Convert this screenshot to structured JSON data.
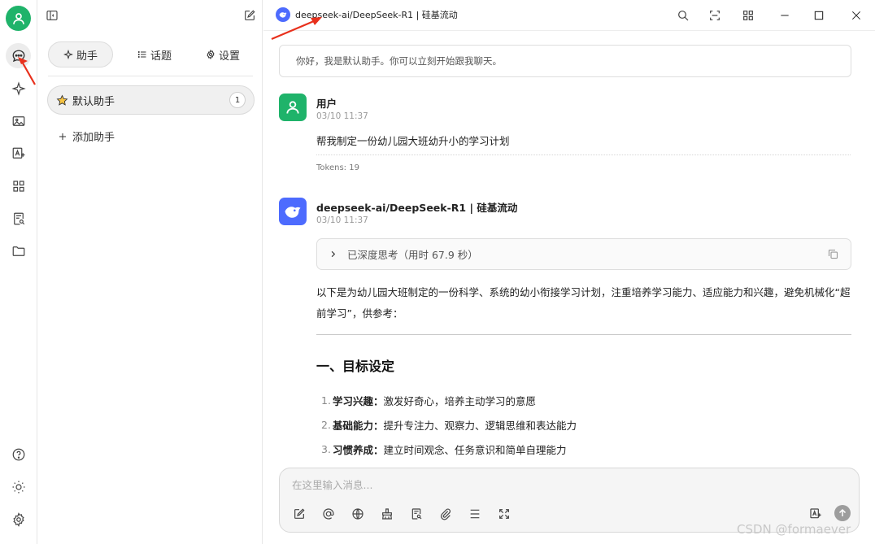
{
  "header": {
    "model_title": "deepseek-ai/DeepSeek-R1 | 硅基流动"
  },
  "sidebar": {
    "tabs": [
      {
        "label": "助手",
        "icon": "sparkle-icon"
      },
      {
        "label": "话题",
        "icon": "list-icon"
      },
      {
        "label": "设置",
        "icon": "gear-icon"
      }
    ],
    "assistants": [
      {
        "name": "默认助手",
        "count": "1"
      }
    ],
    "add_assistant_label": "添加助手"
  },
  "chat": {
    "welcome": "你好，我是默认助手。你可以立刻开始跟我聊天。",
    "user_message": {
      "name": "用户",
      "time": "03/10 11:37",
      "text": "帮我制定一份幼儿园大班幼升小的学习计划",
      "tokens": "Tokens: 19"
    },
    "bot_message": {
      "name": "deepseek-ai/DeepSeek-R1 | 硅基流动",
      "time": "03/10 11:37",
      "thinking": "已深度思考（用时 67.9 秒）",
      "intro": "以下是为幼儿园大班制定的一份科学、系统的幼小衔接学习计划，注重培养学习能力、适应能力和兴趣，避免机械化“超前学习”，供参考：",
      "section_title": "一、目标设定",
      "items": [
        {
          "num": "1.",
          "bold": "学习兴趣：",
          "text": "激发好奇心，培养主动学习的意愿"
        },
        {
          "num": "2.",
          "bold": "基础能力：",
          "text": "提升专注力、观察力、逻辑思维和表达能力"
        },
        {
          "num": "3.",
          "bold": "习惯养成：",
          "text": "建立时间观念、任务意识和简单自理能力"
        }
      ]
    }
  },
  "input": {
    "placeholder": "在这里输入消息..."
  },
  "watermark": "CSDN @formaever",
  "colors": {
    "accent_green": "#1fb36a",
    "deepseek_blue": "#4d6bfe",
    "annotation_red": "#e8301c"
  }
}
